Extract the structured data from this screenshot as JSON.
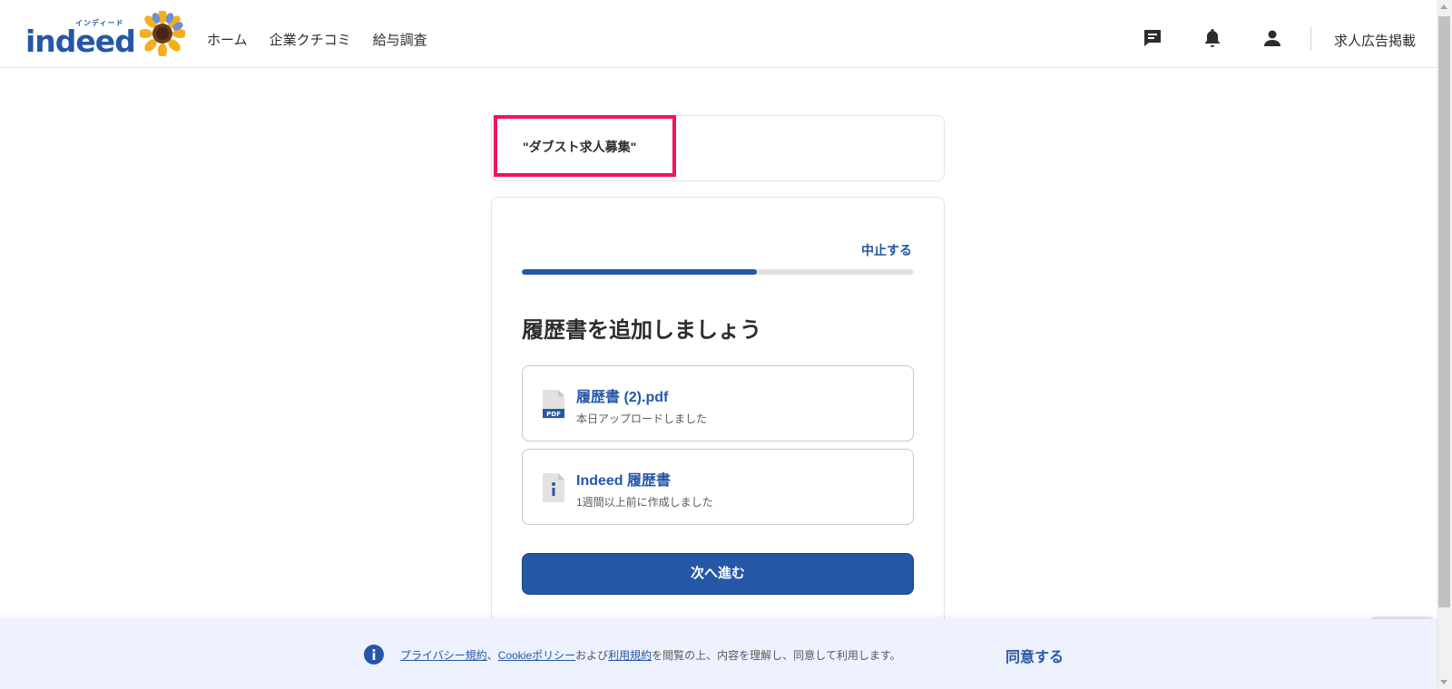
{
  "header": {
    "logo": {
      "kana": "インディード",
      "word": "indeed"
    },
    "nav": [
      "ホーム",
      "企業クチコミ",
      "給与調査"
    ],
    "icons": [
      "messages-icon",
      "notifications-bell-icon",
      "account-icon"
    ],
    "employer_link": "求人広告掲載"
  },
  "job": {
    "title": "\"ダブスト求人募集\""
  },
  "apply": {
    "cancel": "中止する",
    "progress": 0.6,
    "heading": "履歴書を追加しましょう",
    "options": [
      {
        "title": "履歴書 (2).pdf",
        "subtitle": "本日アップロードしました",
        "icon": "pdf-file-icon",
        "icon_badge": "PDF"
      },
      {
        "title": "Indeed 履歴書",
        "subtitle": "1週間以上前に作成しました",
        "icon": "indeed-resume-icon"
      }
    ],
    "next_button": "次へ進む"
  },
  "consent": {
    "privacy_link": "プライバシー規約",
    "sep": "、",
    "cookie_link": "Cookieポリシー",
    "and": "および",
    "terms_link": "利用規約",
    "rest": "を閲覧の上、内容を理解し、同意して利用します。",
    "agree": "同意する"
  },
  "colors": {
    "brand": "#2557a7",
    "highlight": "#f0145a",
    "banner_bg": "#eef1fe"
  }
}
